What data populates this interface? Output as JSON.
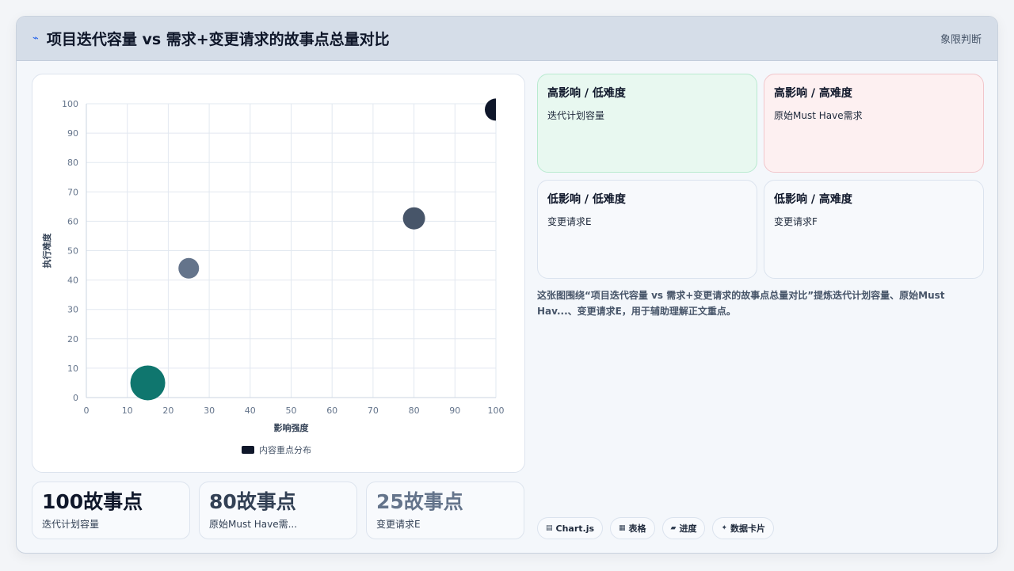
{
  "header": {
    "icon": "lightning-icon",
    "title": "项目迭代容量 vs 需求+变更请求的故事点总量对比",
    "badge": "象限判断"
  },
  "chart_data": {
    "type": "scatter",
    "xlabel": "影响强度",
    "ylabel": "执行难度",
    "xlim": [
      0,
      100
    ],
    "ylim": [
      0,
      100
    ],
    "xticks": [
      "0",
      "10",
      "20",
      "30",
      "40",
      "50",
      "60",
      "70",
      "80",
      "90",
      "100"
    ],
    "yticks": [
      "0",
      "10",
      "20",
      "30",
      "40",
      "50",
      "60",
      "70",
      "80",
      "90",
      "100"
    ],
    "grid": true,
    "legend": {
      "position": "bottom",
      "label": "内容重点分布",
      "color": "#0f172a"
    },
    "points": [
      {
        "x": 100,
        "y": 98,
        "r": 14,
        "color": "#0f172a"
      },
      {
        "x": 80,
        "y": 61,
        "r": 14,
        "color": "#475569"
      },
      {
        "x": 25,
        "y": 44,
        "r": 13,
        "color": "#64748b"
      },
      {
        "x": 15,
        "y": 5,
        "r": 22,
        "color": "#0f766e"
      }
    ]
  },
  "stats": [
    {
      "value": "100故事点",
      "label": "迭代计划容量",
      "color": "#0f172a"
    },
    {
      "value": "80故事点",
      "label": "原始Must Have需...",
      "color": "#334155"
    },
    {
      "value": "25故事点",
      "label": "变更请求E",
      "color": "#64748b"
    }
  ],
  "quadrants": [
    {
      "title": "高影响 / 低难度",
      "item": "迭代计划容量"
    },
    {
      "title": "高影响 / 高难度",
      "item": "原始Must Have需求"
    },
    {
      "title": "低影响 / 低难度",
      "item": "变更请求E"
    },
    {
      "title": "低影响 / 高难度",
      "item": "变更请求F"
    }
  ],
  "description": "这张图围绕“项目迭代容量 vs 需求+变更请求的故事点总量对比”提炼迭代计划容量、原始Must Hav...、变更请求E，用于辅助理解正文重点。",
  "chips": [
    {
      "icon": "chart-icon",
      "label": "Chart.js"
    },
    {
      "icon": "table-icon",
      "label": "表格"
    },
    {
      "icon": "progress-icon",
      "label": "进度"
    },
    {
      "icon": "sparkle-icon",
      "label": "数据卡片"
    }
  ]
}
